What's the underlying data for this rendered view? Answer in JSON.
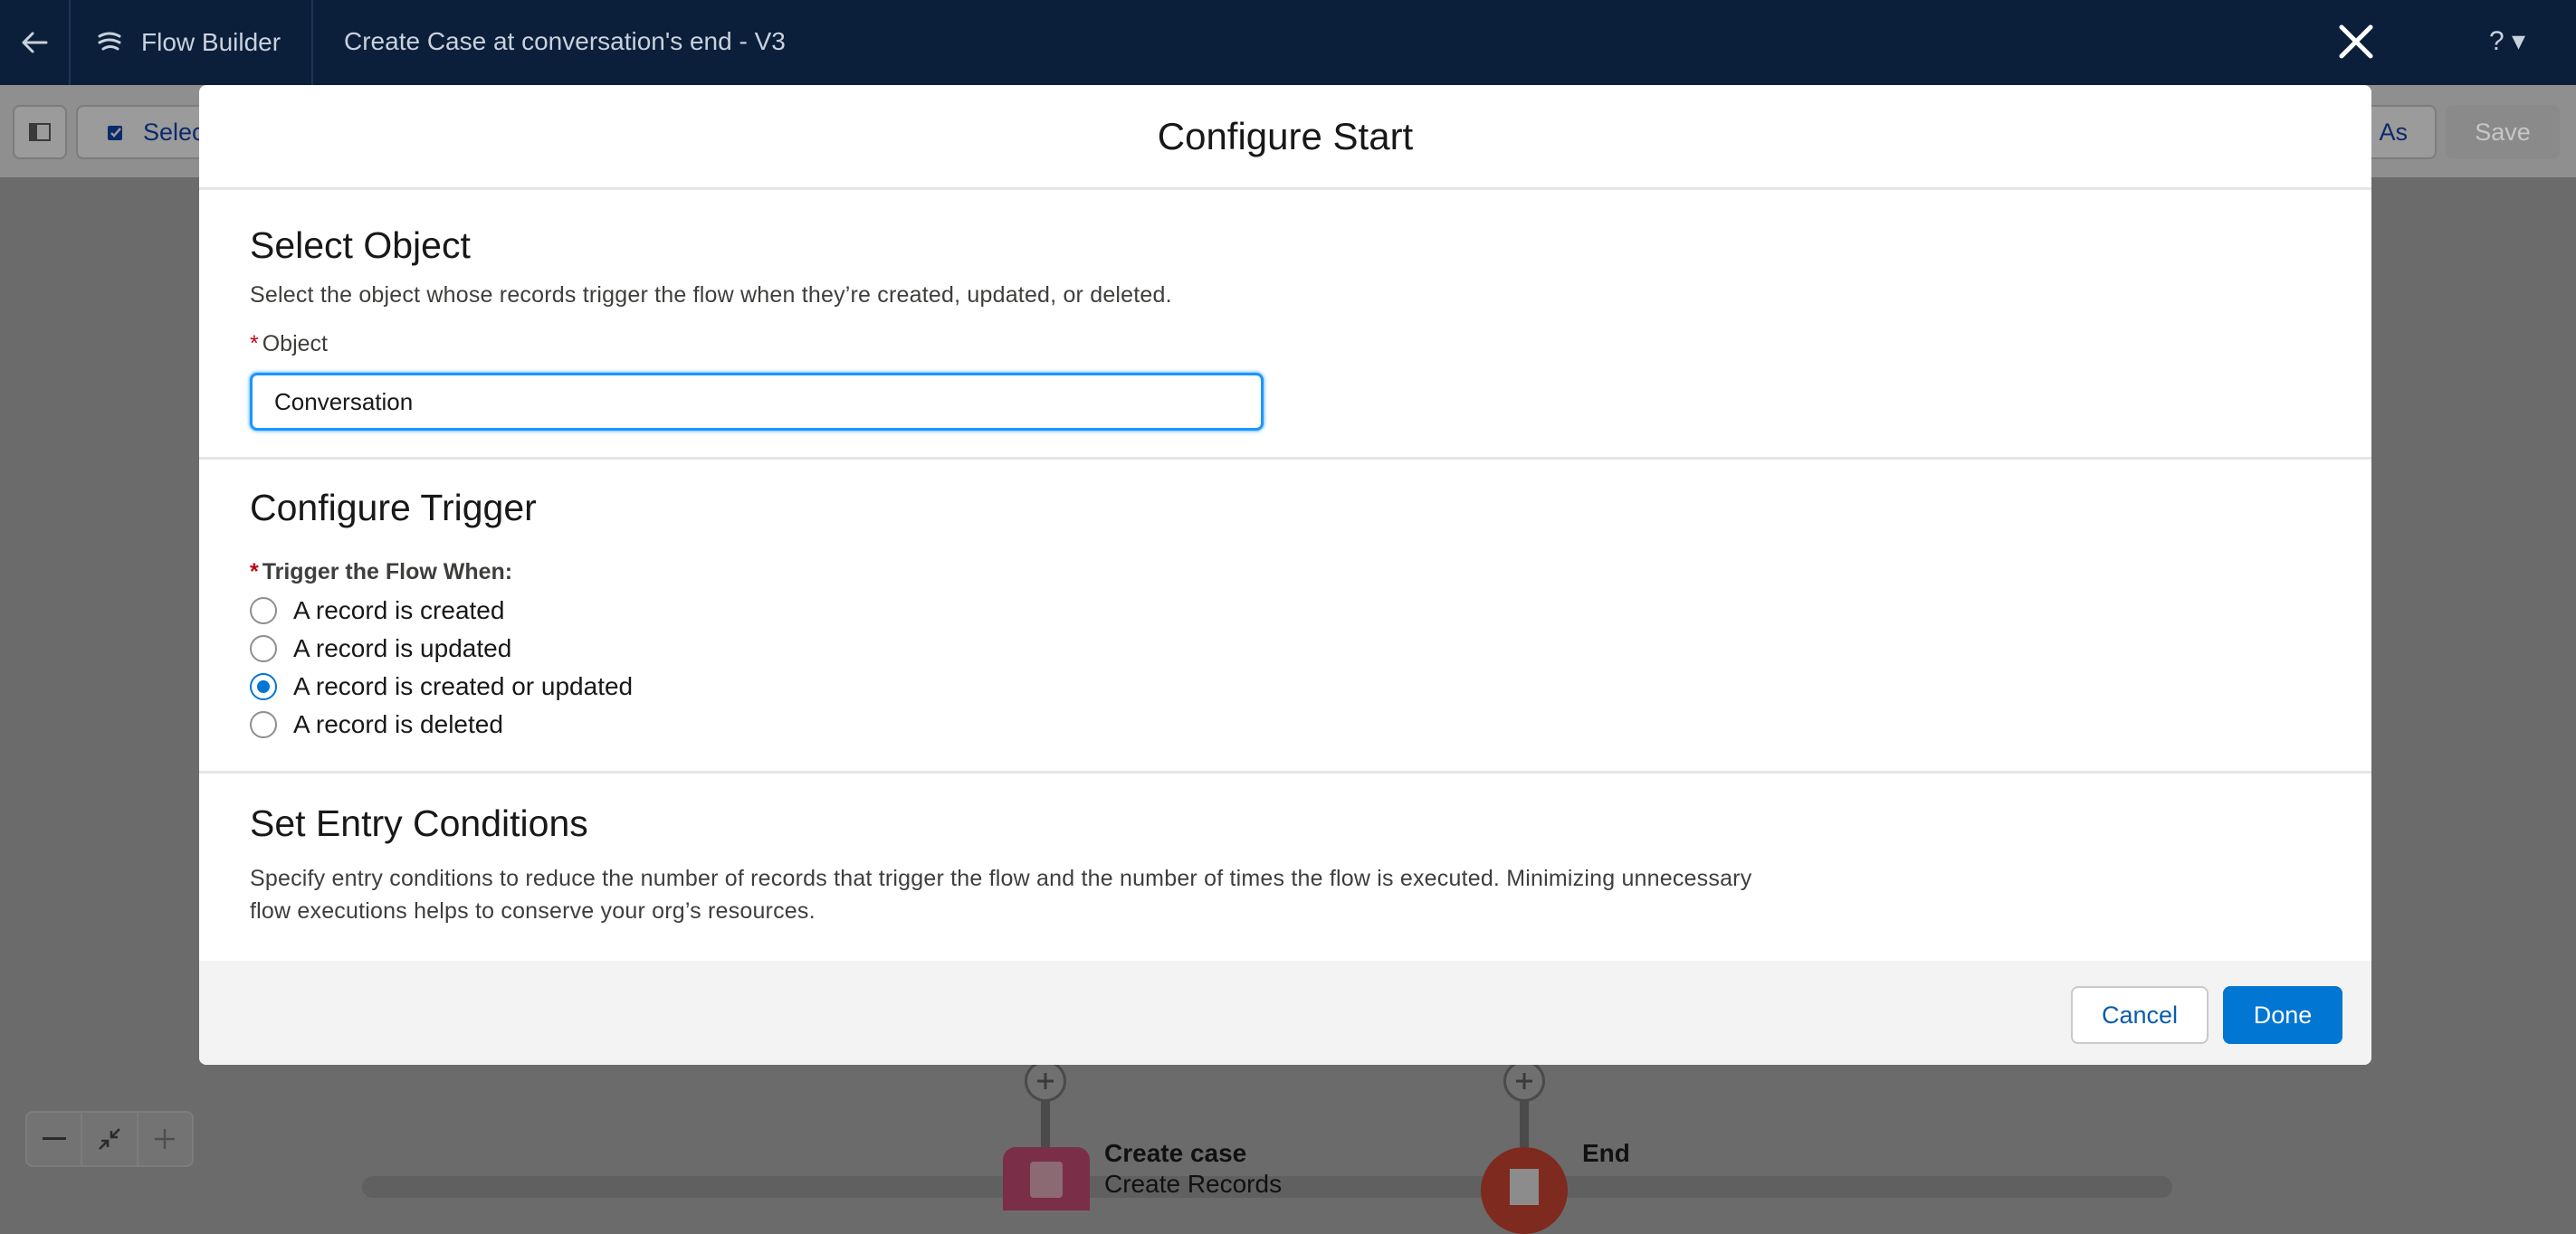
{
  "app": {
    "brand": "Flow Builder",
    "flow_name": "Create Case at conversation's end - V3",
    "help_label": "? ▾"
  },
  "toolbar": {
    "select_label": "Selec",
    "save_as_label": "As",
    "save_label": "Save"
  },
  "canvas": {
    "nodes": [
      {
        "title": "Create case",
        "subtitle": "Create Records"
      },
      {
        "title": "End"
      }
    ]
  },
  "modal": {
    "title": "Configure Start",
    "select_object": {
      "heading": "Select Object",
      "description": "Select the object whose records trigger the flow when they’re created, updated, or deleted.",
      "field_label": "Object",
      "value": "Conversation"
    },
    "configure_trigger": {
      "heading": "Configure Trigger",
      "field_label": "Trigger the Flow When:",
      "options": [
        {
          "label": "A record is created",
          "checked": false
        },
        {
          "label": "A record is updated",
          "checked": false
        },
        {
          "label": "A record is created or updated",
          "checked": true
        },
        {
          "label": "A record is deleted",
          "checked": false
        }
      ]
    },
    "entry_conditions": {
      "heading": "Set Entry Conditions",
      "description_line1": "Specify entry conditions to reduce the number of records that trigger the flow and the number of times the flow is executed. Minimizing unnecessary",
      "description_line2": "flow executions helps to conserve your org’s resources."
    },
    "footer": {
      "cancel_label": "Cancel",
      "done_label": "Done"
    }
  },
  "colors": {
    "brand_blue": "#0176d3",
    "header_navy": "#0b1f3b",
    "required_red": "#ba0517"
  }
}
